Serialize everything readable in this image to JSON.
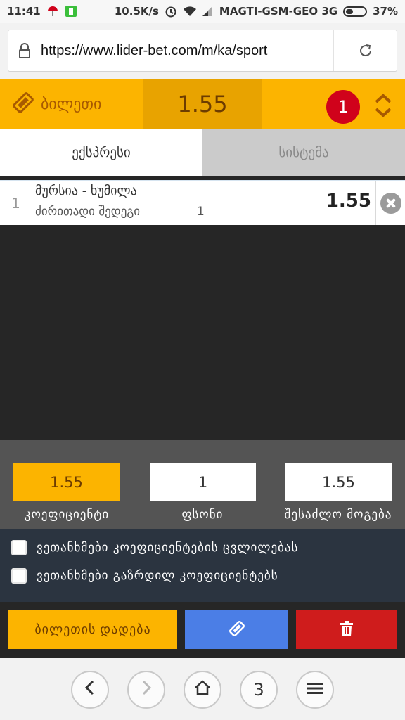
{
  "status_bar": {
    "time": "11:41",
    "network_speed": "10.5K/s",
    "carrier": "MAGTI-GSM-GEO 3G",
    "battery": "37%",
    "battery_level": 0.37
  },
  "browser": {
    "url": "https://www.lider-bet.com/m/ka/sport"
  },
  "ticket": {
    "label": "ბილეთი",
    "total_odds": "1.55",
    "selection_count": "1"
  },
  "tabs": [
    {
      "label": "ექსპრესი",
      "active": true
    },
    {
      "label": "სისტემა",
      "active": false
    }
  ],
  "bets": [
    {
      "index": "1",
      "match": "მურსია - ხუმილა",
      "market": "ძირითადი შედეგი",
      "outcome": "1",
      "odds": "1.55"
    }
  ],
  "totals": {
    "coefficient_value": "1.55",
    "coefficient_label": "კოეფიციენტი",
    "stake_value": "1",
    "stake_label": "ფსონი",
    "win_value": "1.55",
    "win_label": "შესაძლო მოგება"
  },
  "options": [
    {
      "label": "ვეთანხმები კოეფიციენტების ცვლილებას",
      "checked": false
    },
    {
      "label": "ვეთანხმები გაზრდილ კოეფიციენტებს",
      "checked": false
    }
  ],
  "actions": {
    "place_label": "ბილეთის დადება"
  },
  "nav": {
    "tab_count": "3"
  },
  "colors": {
    "brand_yellow": "#fcb400",
    "dark_bg": "#262626",
    "edit_blue": "#4b7ee6",
    "delete_red": "#cf1c1c",
    "badge_red": "#d0021b"
  },
  "icons": {
    "ticket": "ticket-icon",
    "lock": "lock-icon",
    "reload": "reload-icon",
    "remove": "close-circle-icon",
    "edit": "ticket-edit-icon",
    "delete": "trash-icon",
    "back": "chevron-left-icon",
    "forward": "chevron-right-icon",
    "home": "home-icon",
    "menu": "hamburger-icon"
  }
}
